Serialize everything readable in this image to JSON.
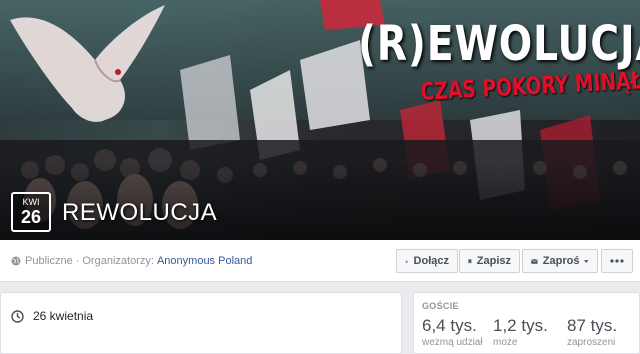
{
  "cover": {
    "title": "(R)EWOLUCJA",
    "subtitle": "CZAS POKORY MINĄŁ!",
    "colors": {
      "title": "#ffffff",
      "subtitle": "#e0102a"
    }
  },
  "event": {
    "month": "KWI",
    "day": "26",
    "name": "REWOLUCJA"
  },
  "privacy": {
    "visibility": "Publiczne",
    "organizers_label": "Organizatorzy:",
    "organizer": "Anonymous Poland"
  },
  "actions": {
    "join": "Dołącz",
    "save": "Zapisz",
    "invite": "Zaproś"
  },
  "details": {
    "date": "26 kwietnia"
  },
  "guests": {
    "header": "GOŚCIE",
    "stats": [
      {
        "value": "6,4 tys.",
        "label": "wezmą udział"
      },
      {
        "value": "1,2 tys.",
        "label": "może"
      },
      {
        "value": "87 tys.",
        "label": "zaproszeni"
      }
    ]
  },
  "colors": {
    "link": "#365899",
    "muted": "#90949c",
    "background": "#e9ebee"
  }
}
